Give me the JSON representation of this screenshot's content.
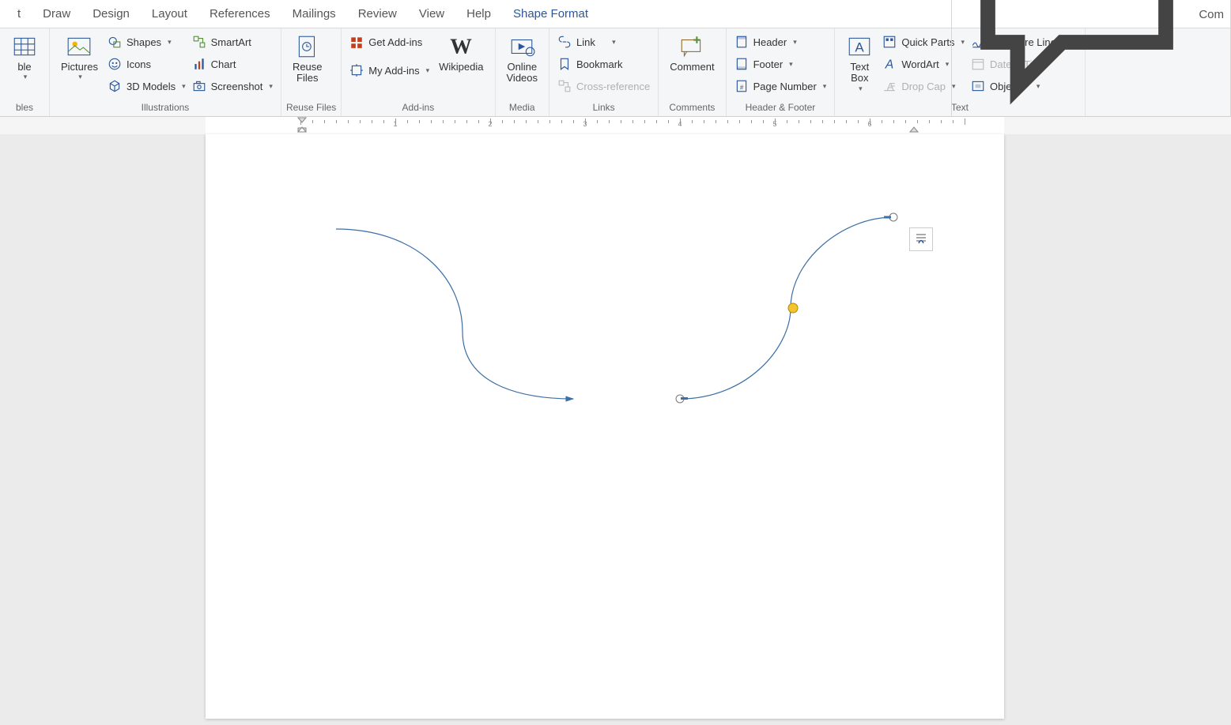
{
  "tabs": {
    "insert_partial": "t",
    "draw": "Draw",
    "design": "Design",
    "layout": "Layout",
    "references": "References",
    "mailings": "Mailings",
    "review": "Review",
    "view": "View",
    "help": "Help",
    "shape_format": "Shape Format"
  },
  "rightbtn": {
    "comments": "Com"
  },
  "ribbon": {
    "tables": {
      "label": "ble",
      "group": "bles"
    },
    "illustrations": {
      "pictures": "Pictures",
      "shapes": "Shapes",
      "icons": "Icons",
      "models3d": "3D Models",
      "smartart": "SmartArt",
      "chart": "Chart",
      "screenshot": "Screenshot",
      "group": "Illustrations"
    },
    "reusefiles": {
      "reuse": "Reuse\nFiles",
      "group": "Reuse Files"
    },
    "addins": {
      "get": "Get Add-ins",
      "my": "My Add-ins",
      "wikipedia": "Wikipedia",
      "group": "Add-ins"
    },
    "media": {
      "online": "Online\nVideos",
      "group": "Media"
    },
    "links": {
      "link": "Link",
      "bookmark": "Bookmark",
      "crossref": "Cross-reference",
      "group": "Links"
    },
    "comments": {
      "comment": "Comment",
      "group": "Comments"
    },
    "headerfooter": {
      "header": "Header",
      "footer": "Footer",
      "page": "Page Number",
      "group": "Header & Footer"
    },
    "text": {
      "textbox": "Text\nBox",
      "quickparts": "Quick Parts",
      "wordart": "WordArt",
      "dropcap": "Drop Cap",
      "sigline": "Signature Line",
      "datetime": "Date & Time",
      "object": "Object",
      "group": "Text"
    }
  },
  "ruler": {
    "marks": [
      1,
      2,
      3,
      4,
      5,
      6
    ]
  }
}
